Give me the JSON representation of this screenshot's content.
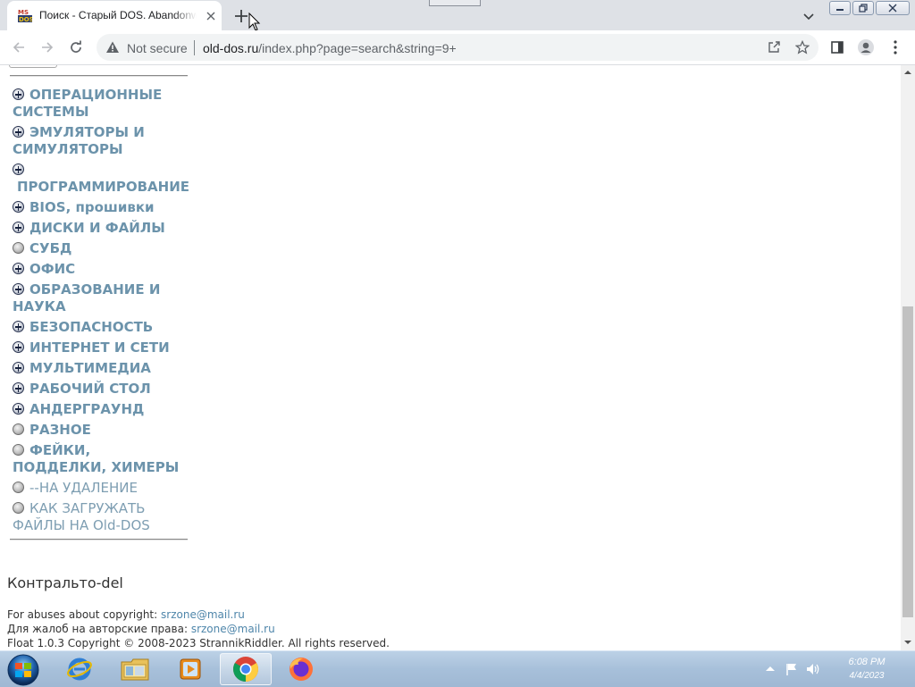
{
  "browser": {
    "tab_title": "Поиск - Старый DOS. Abandonware",
    "address_security_label": "Not secure",
    "url_host": "old-dos.ru",
    "url_path": "/index.php?page=search&string=9+"
  },
  "sidebar": {
    "categories": [
      {
        "label": "ОПЕРАЦИОННЫЕ СИСТЕМЫ",
        "icon": "plus-circle-icon",
        "bold": true
      },
      {
        "label": "ЭМУЛЯТОРЫ И СИМУЛЯТОРЫ",
        "icon": "plus-circle-icon",
        "bold": true
      },
      {
        "label": "ПРОГРАММИРОВАНИЕ",
        "icon": "plus-circle-icon",
        "bold": true
      },
      {
        "label": "BIOS, прошивки",
        "icon": "plus-circle-icon",
        "bold": true
      },
      {
        "label": "ДИСКИ И ФАЙЛЫ",
        "icon": "plus-circle-icon",
        "bold": true
      },
      {
        "label": "СУБД",
        "icon": "gray-dot-icon",
        "bold": true
      },
      {
        "label": "ОФИС",
        "icon": "plus-circle-icon",
        "bold": true
      },
      {
        "label": "ОБРАЗОВАНИЕ И НАУКА",
        "icon": "plus-circle-icon",
        "bold": true
      },
      {
        "label": "БЕЗОПАСНОСТЬ",
        "icon": "plus-circle-icon",
        "bold": true
      },
      {
        "label": "ИНТЕРНЕТ И СЕТИ",
        "icon": "plus-circle-icon",
        "bold": true
      },
      {
        "label": "МУЛЬТИМЕДИА",
        "icon": "plus-circle-icon",
        "bold": true
      },
      {
        "label": "РАБОЧИЙ СТОЛ",
        "icon": "plus-circle-icon",
        "bold": true
      },
      {
        "label": "АНДЕРГРАУНД",
        "icon": "plus-circle-icon",
        "bold": true
      },
      {
        "label": "РАЗНОЕ",
        "icon": "gray-dot-icon",
        "bold": true
      },
      {
        "label": "ФЕЙКИ, ПОДДЕЛКИ, ХИМЕРЫ",
        "icon": "gray-dot-icon",
        "bold": true
      },
      {
        "label": "--НА УДАЛЕНИЕ",
        "icon": "gray-dot-icon",
        "bold": false
      },
      {
        "label": "КАК ЗАГРУЖАТЬ ФАЙЛЫ НА Old-DOS",
        "icon": "gray-dot-icon",
        "bold": false
      }
    ]
  },
  "user": {
    "name": "Контральто-del"
  },
  "footer": {
    "abuse_en_label": "For abuses about copyright:",
    "abuse_en_email": "srzone@mail.ru",
    "abuse_ru_label": "Для жалоб на авторские права:",
    "abuse_ru_email": "srzone@mail.ru",
    "copyright": "Float 1.0.3 Copyright © 2008-2023 StrannikRiddler. All rights reserved."
  },
  "taskbar": {
    "apps": [
      "internet-explorer",
      "file-explorer",
      "media-player",
      "chrome",
      "firefox"
    ],
    "active_app": "chrome",
    "clock_time": "6:08 PM",
    "clock_date": "4/4/2023"
  }
}
